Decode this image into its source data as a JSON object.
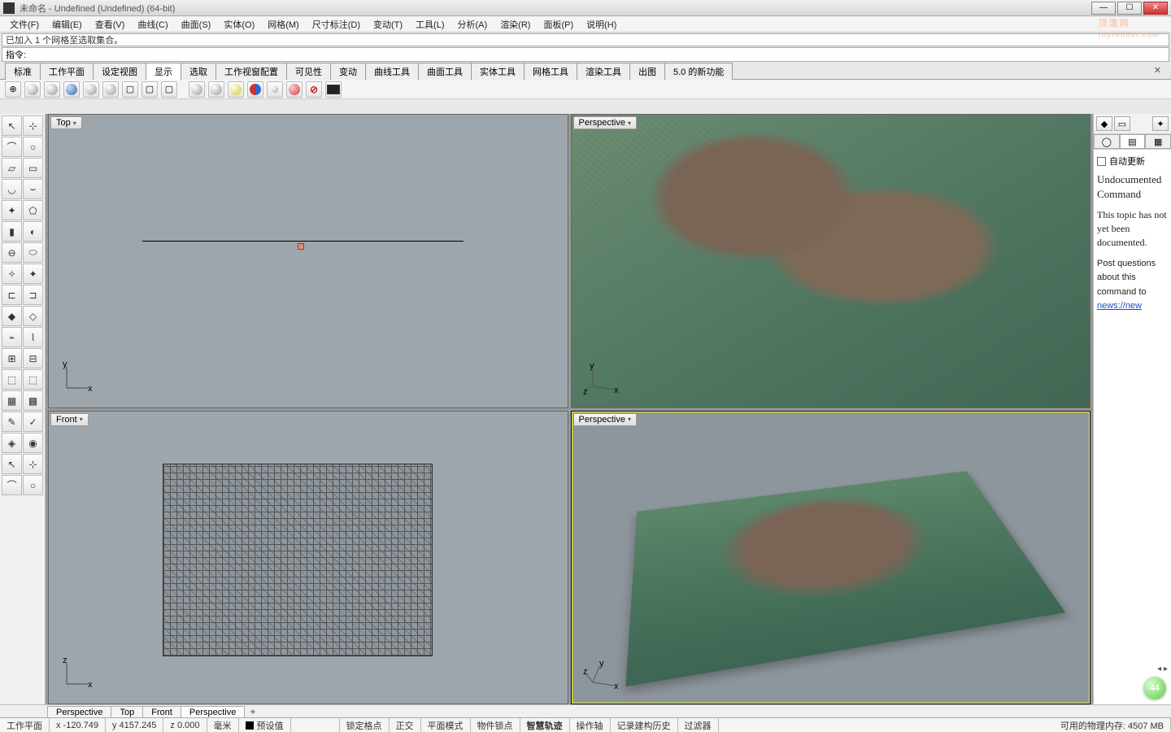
{
  "title": "未命名 - Undefined (Undefined) (64-bit)",
  "menus": [
    "文件(F)",
    "编辑(E)",
    "查看(V)",
    "曲线(C)",
    "曲面(S)",
    "实体(O)",
    "网格(M)",
    "尺寸标注(D)",
    "变动(T)",
    "工具(L)",
    "分析(A)",
    "渲染(R)",
    "面板(P)",
    "说明(H)"
  ],
  "cmd_history": "已加入 1 个网格至选取集合。",
  "cmd_label": "指令:",
  "cmd_value": "",
  "tabs": [
    "标准",
    "工作平面",
    "设定视图",
    "显示",
    "选取",
    "工作视窗配置",
    "可见性",
    "变动",
    "曲线工具",
    "曲面工具",
    "实体工具",
    "网格工具",
    "渲染工具",
    "出图",
    "5.0 的新功能"
  ],
  "tabs_active": "显示",
  "viewports": {
    "tl": "Top",
    "tr": "Perspective",
    "bl": "Front",
    "br": "Perspective"
  },
  "right": {
    "auto_update": "自动更新",
    "h1": "Undocumented Command",
    "p1": "This topic has not yet been documented.",
    "p2": "Post questions about this command to",
    "link": "news://new"
  },
  "vptabs": [
    "Perspective",
    "Top",
    "Front",
    "Perspective"
  ],
  "vptabs_active": 3,
  "status": {
    "cplane": "工作平面",
    "x": "x -120.749",
    "y": "y 4157.245",
    "z": "z 0.000",
    "unit": "毫米",
    "preset": "预设值",
    "cells": [
      "锁定格点",
      "正交",
      "平面模式",
      "物件锁点",
      "智慧轨迹",
      "操作轴",
      "记录建构历史",
      "过滤器"
    ],
    "bold_cell": "智慧轨迹",
    "mem": "可用的物理内存: 4507 MB"
  },
  "watermark": "顶渲网",
  "watermark_sub": "toprender.com",
  "badge": "44"
}
